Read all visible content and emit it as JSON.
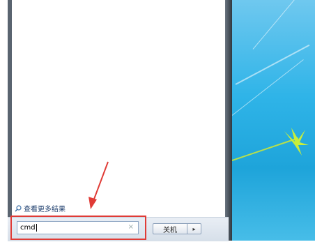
{
  "start_menu": {
    "see_more_results": "查看更多结果",
    "search_value": "cmd",
    "clear_symbol": "×",
    "shutdown_label": "关机",
    "shutdown_arrow": "▸"
  },
  "annotation": {
    "highlight_color": "#e03b36"
  },
  "icons": {
    "search": "search-icon",
    "arrow": "red-arrow-icon"
  }
}
